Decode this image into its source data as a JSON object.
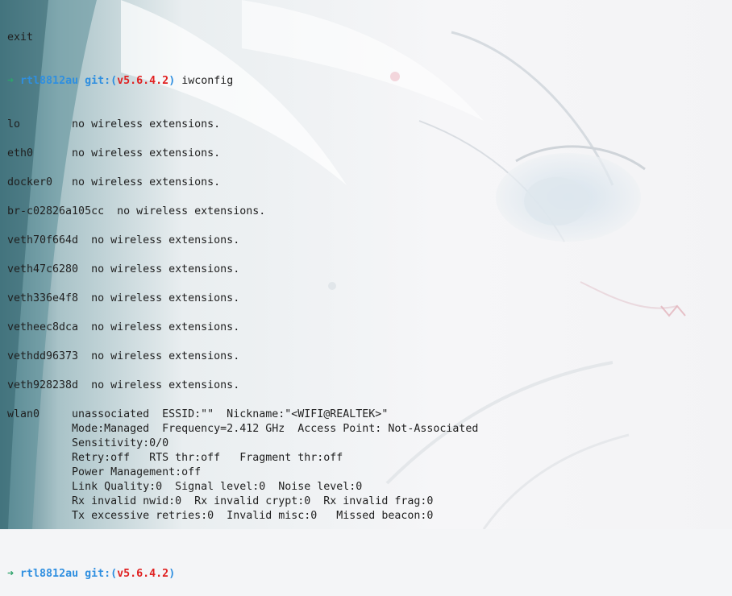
{
  "terminal": {
    "pre_line": "exit",
    "prompt1": {
      "arrow": "➜",
      "dir": "rtl8812au",
      "git_open": "git:(",
      "branch": "v5.6.4.2",
      "git_close": ")",
      "command": "iwconfig"
    },
    "output": [
      "lo        no wireless extensions.",
      "",
      "eth0      no wireless extensions.",
      "",
      "docker0   no wireless extensions.",
      "",
      "br-c02826a105cc  no wireless extensions.",
      "",
      "veth70f664d  no wireless extensions.",
      "",
      "veth47c6280  no wireless extensions.",
      "",
      "veth336e4f8  no wireless extensions.",
      "",
      "vetheec8dca  no wireless extensions.",
      "",
      "vethdd96373  no wireless extensions.",
      "",
      "veth928238d  no wireless extensions.",
      "",
      "wlan0     unassociated  ESSID:\"\"  Nickname:\"<WIFI@REALTEK>\"",
      "          Mode:Managed  Frequency=2.412 GHz  Access Point: Not-Associated",
      "          Sensitivity:0/0",
      "          Retry:off   RTS thr:off   Fragment thr:off",
      "          Power Management:off",
      "          Link Quality:0  Signal level:0  Noise level:0",
      "          Rx invalid nwid:0  Rx invalid crypt:0  Rx invalid frag:0",
      "          Tx excessive retries:0  Invalid misc:0   Missed beacon:0",
      ""
    ],
    "prompt2": {
      "arrow": "➜",
      "dir": "rtl8812au",
      "git_open": "git:(",
      "branch": "v5.6.4.2",
      "git_close": ")"
    }
  },
  "colors": {
    "background": "#f4f5f7",
    "text": "#1f1f1f",
    "prompt_arrow": "#2ea36b",
    "prompt_dir": "#2f8fe0",
    "git_branch": "#e02020"
  }
}
